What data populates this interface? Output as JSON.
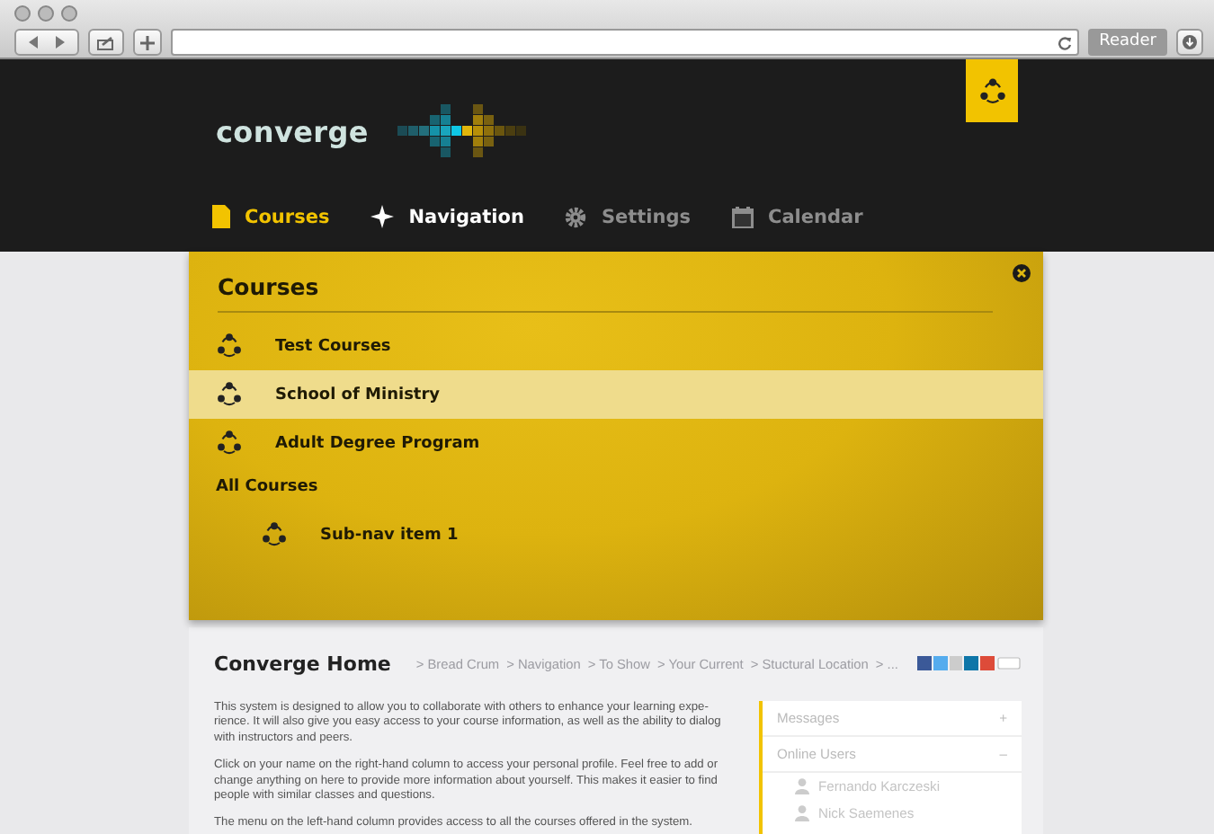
{
  "browser": {
    "reader_label": "Reader"
  },
  "header": {
    "logo": "converge",
    "nav": [
      {
        "label": "Courses",
        "selected": true,
        "highlighted": false
      },
      {
        "label": "Navigation",
        "selected": false,
        "highlighted": true
      },
      {
        "label": "Settings",
        "selected": false,
        "highlighted": false
      },
      {
        "label": "Calendar",
        "selected": false,
        "highlighted": false
      }
    ]
  },
  "courses_panel": {
    "title": "Courses",
    "items": [
      {
        "label": "Test Courses",
        "selected": false
      },
      {
        "label": "School of Ministry",
        "selected": true
      },
      {
        "label": "Adult Degree Program",
        "selected": false
      }
    ],
    "section": "All Courses",
    "sub_items": [
      {
        "label": "Sub-nav item 1",
        "selected": false
      }
    ]
  },
  "home": {
    "title": "Converge Home",
    "breadcrumbs": [
      "> Bread Crum",
      "> Navigation",
      "> To Show",
      "> Your Current",
      "> Stuctural Location",
      "> ..."
    ],
    "paragraphs": [
      "This system is designed to allow you to collaborate with others to enhance your learning expe-rience. It will also give you easy access to your course information, as well as the ability to dialog with instructors and peers.",
      "Click on your name on the right-hand column to access your personal profile. Feel free to add or change anything on here to provide more information about yourself. This makes it easier to find people with similar classes and questions.",
      "The menu on the left-hand column provides access to all the courses offered in the system."
    ],
    "sidebar": [
      {
        "title": "Messages",
        "toggle": "+"
      },
      {
        "title": "Online Users",
        "toggle": "–",
        "users": [
          "Fernando Karczeski",
          "Nick Saemenes"
        ]
      }
    ]
  }
}
